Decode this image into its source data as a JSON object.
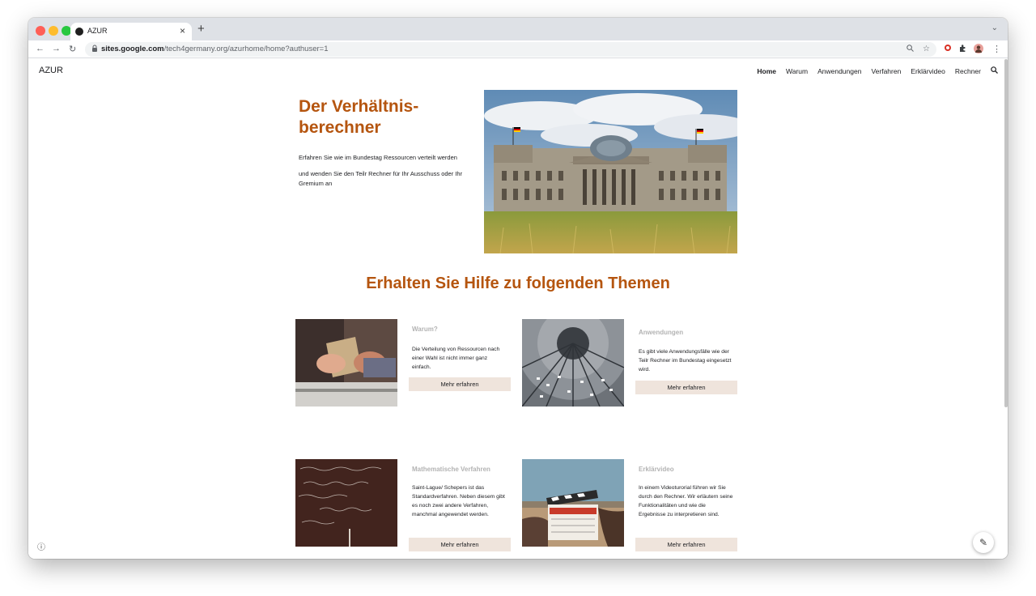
{
  "browser": {
    "tab_title": "AZUR",
    "tab_close": "×",
    "new_tab": "+",
    "url_host": "sites.google.com",
    "url_path": "/tech4germany.org/azurhome/home?authuser=1"
  },
  "site": {
    "brand": "AZUR",
    "nav": [
      "Home",
      "Warum",
      "Anwendungen",
      "Verfahren",
      "Erklärvideo",
      "Rechner"
    ]
  },
  "hero": {
    "title_line1": "Der Verhältnis-",
    "title_line2": "berechner",
    "text1": "Erfahren Sie wie im Bundestag Ressourcen verteilt werden",
    "text2": "und wenden Sie den Teilr Rechner für Ihr Ausschuss oder Ihr Gremium an"
  },
  "section_title": "Erhalten Sie Hilfe zu folgenden Themen",
  "cards": [
    {
      "heading": "Warum?",
      "text": "Die Verteilung von Ressourcen nach einer Wahl ist nicht immer ganz einfach.",
      "button": "Mehr erfahren"
    },
    {
      "heading": "Anwendungen",
      "text": "Es gibt viele Anwendungsfälle wie der Teilr Rechner im Bundestag eingesetzt wird.",
      "button": "Mehr erfahren"
    },
    {
      "heading": "Mathematische Verfahren",
      "text": "Saint-Lague/ Schepers ist das Standardverfahren. Neben diesem gibt es noch zwei andere Verfahren, manchmal angewendet werden.",
      "button": "Mehr erfahren"
    },
    {
      "heading": "Erklärvideo",
      "text": "In einem Videoturorial führen wir Sie durch den Rechner. Wir erläutern seine Funktionalitäten und wie die Ergebnisse zu interpretieren sind.",
      "button": "Mehr erfahren"
    }
  ],
  "colors": {
    "accent": "#b5550f",
    "button_bg": "#efe4dc",
    "card_heading": "#b3b3b3"
  }
}
